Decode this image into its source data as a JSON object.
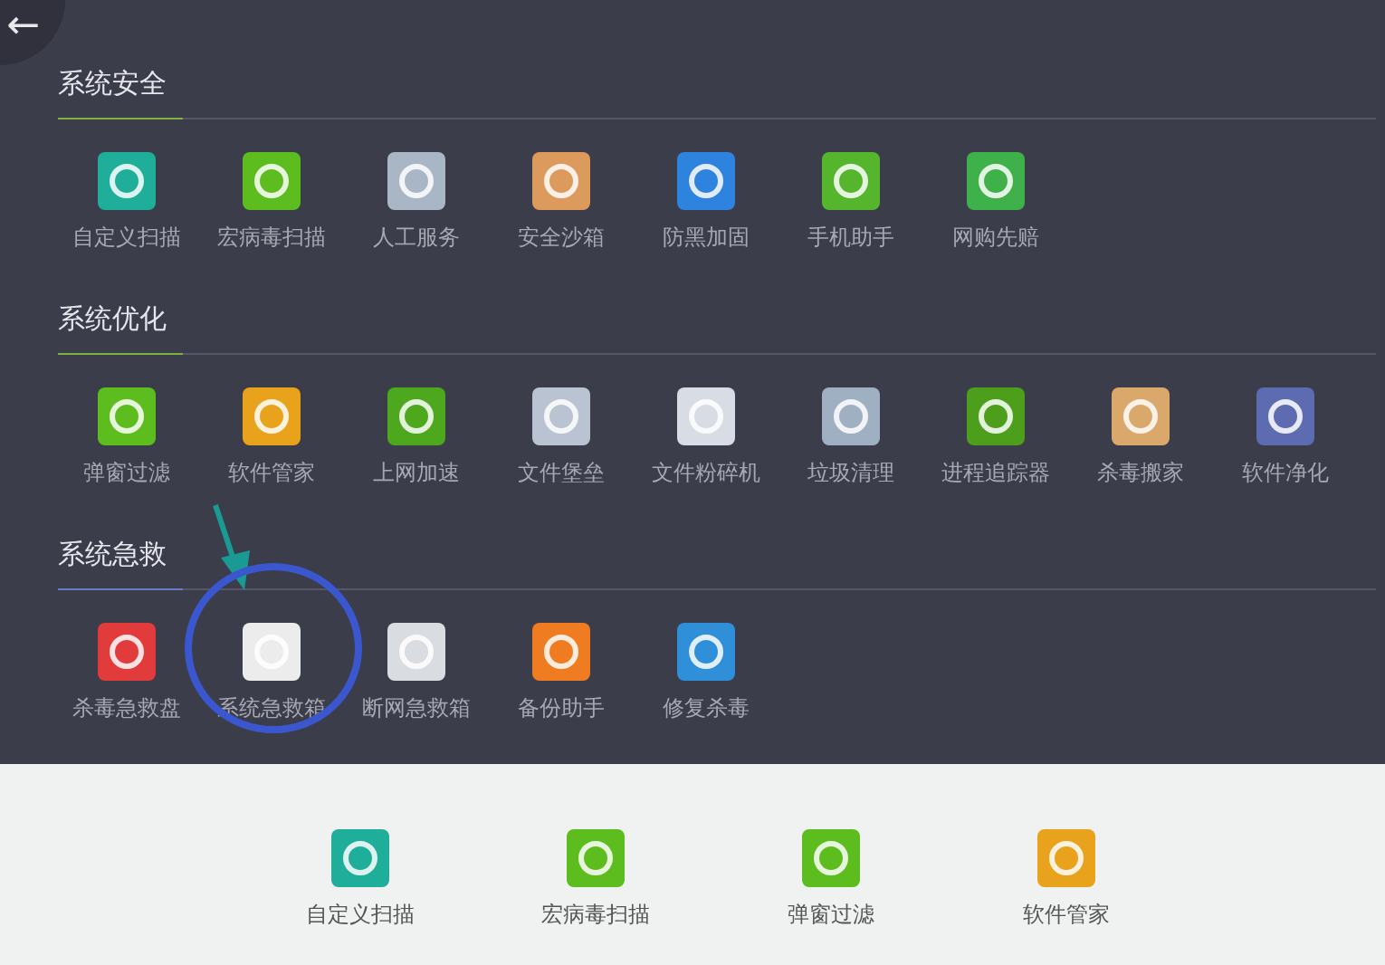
{
  "back_button": {
    "icon": "←"
  },
  "sections": [
    {
      "title": "系统安全",
      "color": "#7ab342",
      "items": [
        {
          "label": "自定义扫描",
          "color": "#1fae9a"
        },
        {
          "label": "宏病毒扫描",
          "color": "#5ebd1e"
        },
        {
          "label": "人工服务",
          "color": "#a9b6c6"
        },
        {
          "label": "安全沙箱",
          "color": "#dc9a5c"
        },
        {
          "label": "防黑加固",
          "color": "#2e83de"
        },
        {
          "label": "手机助手",
          "color": "#55b52c"
        },
        {
          "label": "网购先赔",
          "color": "#3fb14a"
        }
      ]
    },
    {
      "title": "系统优化",
      "color": "#7ab342",
      "items": [
        {
          "label": "弹窗过滤",
          "color": "#5ebd1e"
        },
        {
          "label": "软件管家",
          "color": "#e8a21c"
        },
        {
          "label": "上网加速",
          "color": "#4ea81e"
        },
        {
          "label": "文件堡垒",
          "color": "#b9c3d1"
        },
        {
          "label": "文件粉碎机",
          "color": "#d8dde5"
        },
        {
          "label": "垃圾清理",
          "color": "#9fb0c3"
        },
        {
          "label": "进程追踪器",
          "color": "#4c9e1b"
        },
        {
          "label": "杀毒搬家",
          "color": "#d9a86a"
        },
        {
          "label": "软件净化",
          "color": "#5d6bb0"
        }
      ]
    },
    {
      "title": "系统急救",
      "color": "#6a79c8",
      "items": [
        {
          "label": "杀毒急救盘",
          "color": "#e23b3b"
        },
        {
          "label": "系统急救箱",
          "color": "#ececec"
        },
        {
          "label": "断网急救箱",
          "color": "#d9dce1"
        },
        {
          "label": "备份助手",
          "color": "#f07c22"
        },
        {
          "label": "修复杀毒",
          "color": "#2f8fd8"
        }
      ]
    }
  ],
  "shortcuts": [
    {
      "label": "自定义扫描",
      "color": "#1fae9a"
    },
    {
      "label": "宏病毒扫描",
      "color": "#5ebd1e"
    },
    {
      "label": "弹窗过滤",
      "color": "#5ebd1e"
    },
    {
      "label": "软件管家",
      "color": "#e8a21c"
    }
  ]
}
